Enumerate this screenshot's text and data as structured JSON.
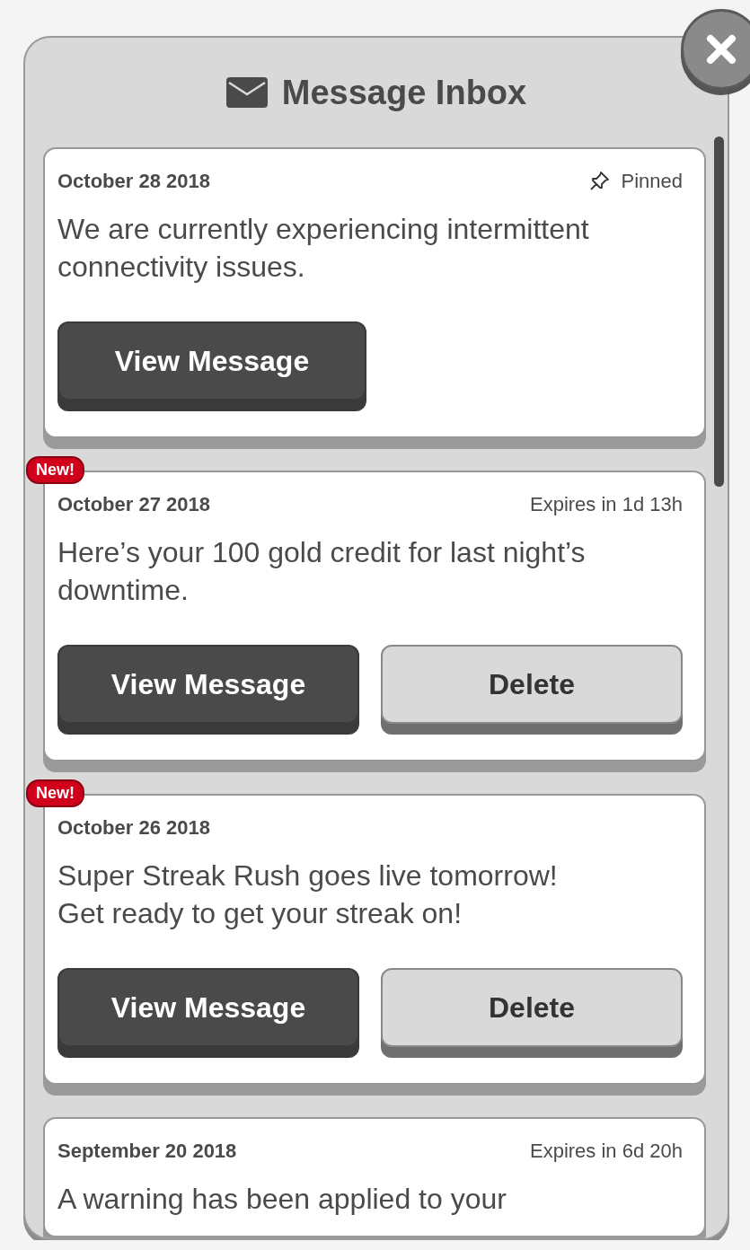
{
  "window": {
    "title": "Message Inbox"
  },
  "messages": [
    {
      "date": "October 28 2018",
      "status": "Pinned",
      "pinned": true,
      "new": false,
      "text": "We are currently experiencing intermittent connectivity issues.",
      "buttons": [
        {
          "label": "View Message",
          "kind": "primary"
        }
      ]
    },
    {
      "date": "October 27 2018",
      "status": "Expires in 1d 13h",
      "pinned": false,
      "new": true,
      "badge": "New!",
      "text": "Here’s your 100 gold credit for last night’s downtime.",
      "buttons": [
        {
          "label": "View Message",
          "kind": "primary"
        },
        {
          "label": "Delete",
          "kind": "secondary"
        }
      ]
    },
    {
      "date": "October 26 2018",
      "pinned": false,
      "new": true,
      "badge": "New!",
      "text": "Super Streak Rush goes live tomorrow! Get ready to get your streak on!",
      "buttons": [
        {
          "label": "View Message",
          "kind": "primary"
        },
        {
          "label": "Delete",
          "kind": "secondary"
        }
      ]
    },
    {
      "date": "September 20 2018",
      "status": "Expires in 6d 20h",
      "pinned": false,
      "new": false,
      "text": "A warning has been applied to your"
    }
  ]
}
